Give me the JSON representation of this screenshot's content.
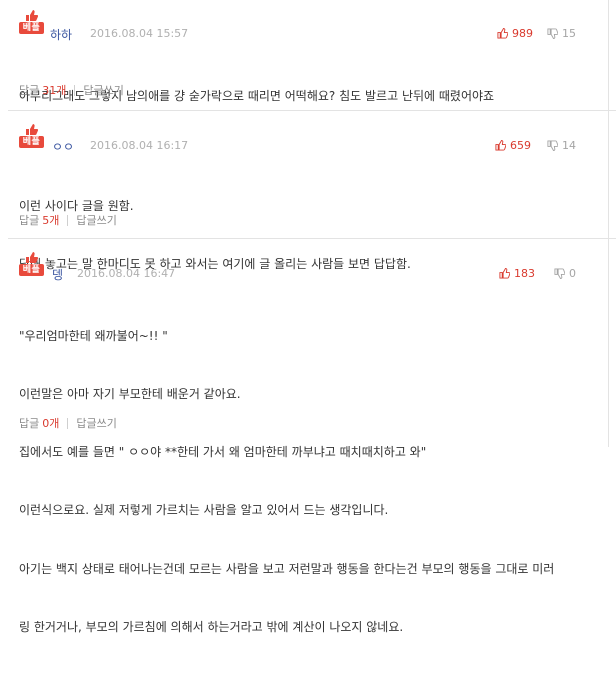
{
  "best_badge_label": "베플",
  "comments": [
    {
      "author": "하하",
      "date": "2016.08.04 15:57",
      "likes": "989",
      "dislikes": "15",
      "lines": [
        "아무리그래도 그렇지 남의애를 걍 숟가락으로 때리면 어떡해요? 침도 발르고 난뒤에 때렸어야죠"
      ],
      "reply_label": "답글",
      "reply_count": "31개",
      "reply_write": "답글쓰기"
    },
    {
      "author": "ㅇㅇ",
      "date": "2016.08.04 16:17",
      "likes": "659",
      "dislikes": "14",
      "lines": [
        "이런 사이다 글을 원함.",
        "당해 놓고는 말 한마디도 못 하고 와서는 여기에 글 올리는 사람들 보면 답답함."
      ],
      "reply_label": "답글",
      "reply_count": "5개",
      "reply_write": "답글쓰기"
    },
    {
      "author": "뎅",
      "date": "2016.08.04 16:47",
      "likes": "183",
      "dislikes": "0",
      "lines": [
        "\"우리엄마한테 왜까불어~!! \"",
        "이런말은 아마 자기 부모한테 배운거 같아요.",
        "집에서도 예를 들면 \" ㅇㅇ야 **한테 가서 왜 엄마한테 까부냐고 때치때치하고 와\"",
        "이런식으로요. 실제 저렇게 가르치는 사람을 알고 있어서 드는 생각입니다.",
        "아기는 백지 상태로 태어나는건데 모르는 사람을 보고 저런말과 행동을 한다는건 부모의 행동을 그대로 미러",
        "링 한거거나, 부모의 가르침에 의해서 하는거라고 밖에 계산이 나오지 않네요."
      ],
      "reply_label": "답글",
      "reply_count": "0개",
      "reply_write": "답글쓰기"
    }
  ]
}
